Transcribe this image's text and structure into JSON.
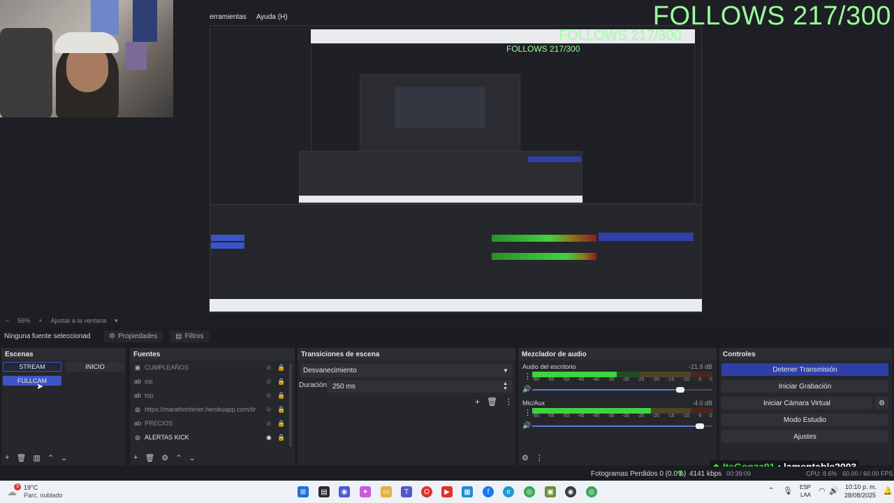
{
  "menu": {
    "items": [
      "erramientas",
      "Ayuda (H)"
    ]
  },
  "overlay": {
    "follows_text": "FOLLOWS 217/300"
  },
  "zoom": {
    "level": "56%",
    "fit_label": "Ajustar a la ventana"
  },
  "source_toolbar": {
    "selected_label": "Ninguna fuente seleccionad",
    "properties_label": "Propiedades",
    "filters_label": "Filtros"
  },
  "scenes": {
    "title": "Escenas",
    "items": [
      {
        "label": "STREAM",
        "active": false
      },
      {
        "label": "INICIO",
        "active": false
      },
      {
        "label": "FULLCAM",
        "active": true
      }
    ]
  },
  "sources": {
    "title": "Fuentes",
    "items": [
      {
        "label": "CUMPLEAÑOS",
        "icon": "image-icon",
        "visible": false
      },
      {
        "label": "osi",
        "icon": "text-icon",
        "visible": false
      },
      {
        "label": "top",
        "icon": "text-icon",
        "visible": false
      },
      {
        "label": "https://marathontimer.herokuapp.com/tir",
        "icon": "browser-icon",
        "visible": false
      },
      {
        "label": "PRECIOS",
        "icon": "text-icon",
        "visible": false
      },
      {
        "label": "ALERTAS KICK",
        "icon": "browser-icon",
        "visible": true
      }
    ]
  },
  "transitions": {
    "title": "Transiciones de escena",
    "selected": "Desvanecimiento",
    "duration_label": "Duración",
    "duration_value": "250 ms"
  },
  "mixer": {
    "title": "Mezclador de audio",
    "channels": [
      {
        "name": "Audio del escritorio",
        "db": "-21.9 dB",
        "level": 0.47,
        "volume": 0.82
      },
      {
        "name": "Mic/Aux",
        "db": "-4.0 dB",
        "level": 0.66,
        "volume": 0.93
      }
    ],
    "scale": [
      "-60",
      "-55",
      "-50",
      "-45",
      "-40",
      "-35",
      "-30",
      "-25",
      "-20",
      "-15",
      "-10",
      "-5",
      "0"
    ]
  },
  "controls": {
    "title": "Controles",
    "buttons": [
      "Detener Transmisión",
      "Iniciar Grabación",
      "Iniciar Cámara Virtual",
      "Modo Estudio",
      "Ajustes"
    ]
  },
  "chat": {
    "user": "ItsGonza91",
    "message": ": lamentable2003"
  },
  "status": {
    "dropped_frames": "Fotogramas Perdidos 0 (0.0%)",
    "bitrate": "4141 kbps",
    "time": "00:39:09",
    "cpu": "CPU: 8.6%",
    "fps": "60.00 / 60.00 FPS"
  },
  "taskbar": {
    "weather_temp": "19°C",
    "weather_desc": "Parc. nublado",
    "weather_badge": "3",
    "lang": "ESP",
    "lang_sub": "LAA",
    "clock_time": "10:10 p. m.",
    "clock_date": "28/08/2025"
  },
  "colors": {
    "accent": "#2f3fa8",
    "green": "#3fd33f",
    "follows": "#9cff9c"
  }
}
